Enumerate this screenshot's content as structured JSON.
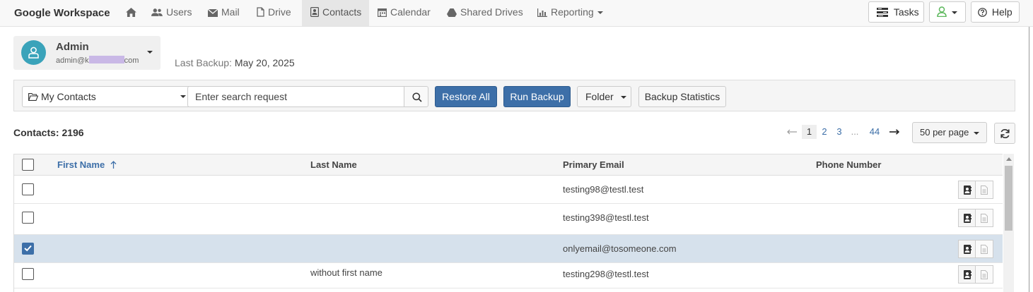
{
  "brand": "Google Workspace",
  "nav": {
    "items": [
      {
        "label": "",
        "icon": "home-icon"
      },
      {
        "label": "Users",
        "icon": "users-icon"
      },
      {
        "label": "Mail",
        "icon": "envelope-icon"
      },
      {
        "label": "Drive",
        "icon": "file-icon"
      },
      {
        "label": "Contacts",
        "icon": "contact-card-icon",
        "active": true
      },
      {
        "label": "Calendar",
        "icon": "calendar-icon"
      },
      {
        "label": "Shared Drives",
        "icon": "drive-icon"
      },
      {
        "label": "Reporting",
        "icon": "bar-chart-icon"
      }
    ],
    "tasks_label": "Tasks",
    "help_label": "Help"
  },
  "account": {
    "name": "Admin",
    "email_prefix": "admin@",
    "email_visible_char": "k",
    "email_suffix": "com"
  },
  "last_backup": {
    "label": "Last Backup:",
    "value": "May 20, 2025"
  },
  "toolbar": {
    "folder": "My Contacts",
    "search_placeholder": "Enter search request",
    "restore_all": "Restore All",
    "run_backup": "Run Backup",
    "folder_btn": "Folder",
    "backup_stats": "Backup Statistics"
  },
  "contacts_count": "Contacts: 2196",
  "pagination": {
    "pages": [
      "1",
      "2",
      "3",
      "...",
      "44"
    ],
    "current": "1",
    "per_page": "50 per page"
  },
  "table": {
    "columns": [
      "First Name",
      "Last Name",
      "Primary Email",
      "Phone Number"
    ],
    "sorted_column": "First Name",
    "rows": [
      {
        "first": "",
        "last": "",
        "email": "testing98@testl.test",
        "phone": "",
        "checked": false
      },
      {
        "first": "",
        "last": "",
        "email": "testing398@testl.test",
        "phone": "",
        "checked": false
      },
      {
        "first": "",
        "last": "",
        "email": "onlyemail@tosomeone.com",
        "phone": "",
        "checked": true
      },
      {
        "first": "",
        "last": "without first name",
        "email": "testing298@testl.test",
        "phone": "",
        "checked": false
      }
    ]
  },
  "colors": {
    "primary": "#3d6fa8",
    "avatar": "#3aa3ba",
    "selected_row": "#d6e1ec",
    "status_green": "#5cb85c"
  }
}
